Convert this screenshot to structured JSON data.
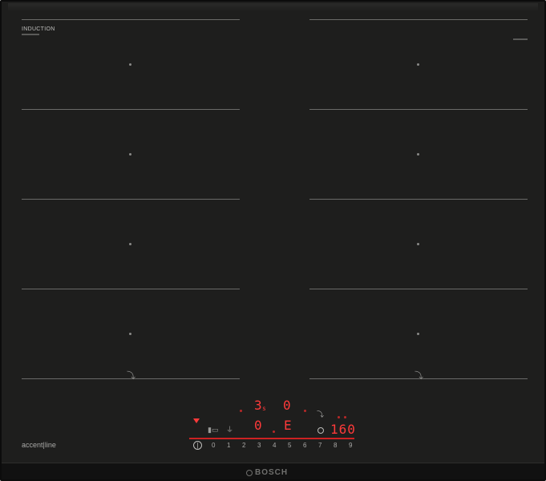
{
  "hob": {
    "label_top": "INDUCTION",
    "accent_label": "accent|line",
    "brand": "BOSCH"
  },
  "display": {
    "zone_level": "3",
    "zone_level_sub": "s",
    "zone_right": "0",
    "zone_level_2": "0",
    "zone_e": "E",
    "timer_value": "160"
  },
  "scale": [
    "0",
    "1",
    "2",
    "3",
    "4",
    "5",
    "6",
    "7",
    "8",
    "9"
  ],
  "colors": {
    "panel": "#1e1e1d",
    "display_red": "#ff3a3a"
  },
  "icons": {
    "power": "power-icon",
    "flex_zone": "flex-zone-icon",
    "timer": "timer-icon"
  }
}
